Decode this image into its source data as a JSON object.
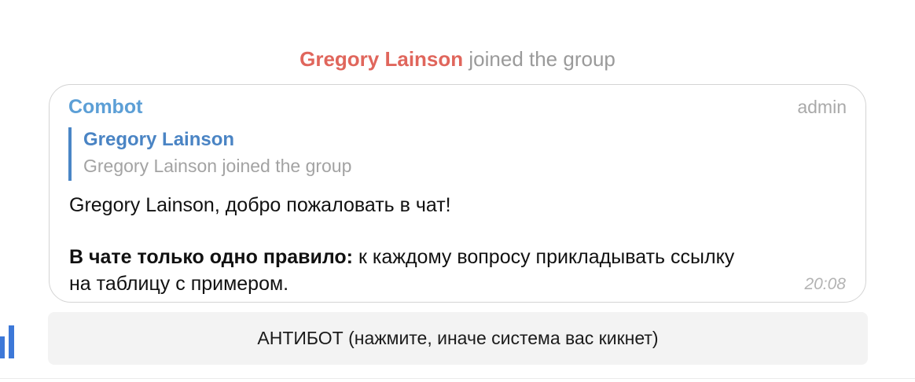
{
  "service_message": {
    "user": "Gregory Lainson",
    "text": " joined the group"
  },
  "message": {
    "sender": "Combot",
    "role": "admin",
    "reply": {
      "name": "Gregory Lainson",
      "text": "Gregory Lainson joined the group"
    },
    "greeting": "Gregory Lainson, добро пожаловать в чат!",
    "rule_bold": "В чате только одно правило:",
    "rule_text": " к каждому вопросу прикладывать ссылку",
    "rule_text_2": "на таблицу с примером.",
    "time": "20:08"
  },
  "inline_button": {
    "label": "АНТИБОТ (нажмите, иначе система вас кикнет)"
  },
  "icons": {
    "left_edge": "bar-chart-icon"
  },
  "colors": {
    "service_name": "#e0665c",
    "sender": "#5c9fd6",
    "reply_bar": "#4a86c6",
    "reply_name": "#4a84c4",
    "button_bg": "#f3f3f3"
  }
}
